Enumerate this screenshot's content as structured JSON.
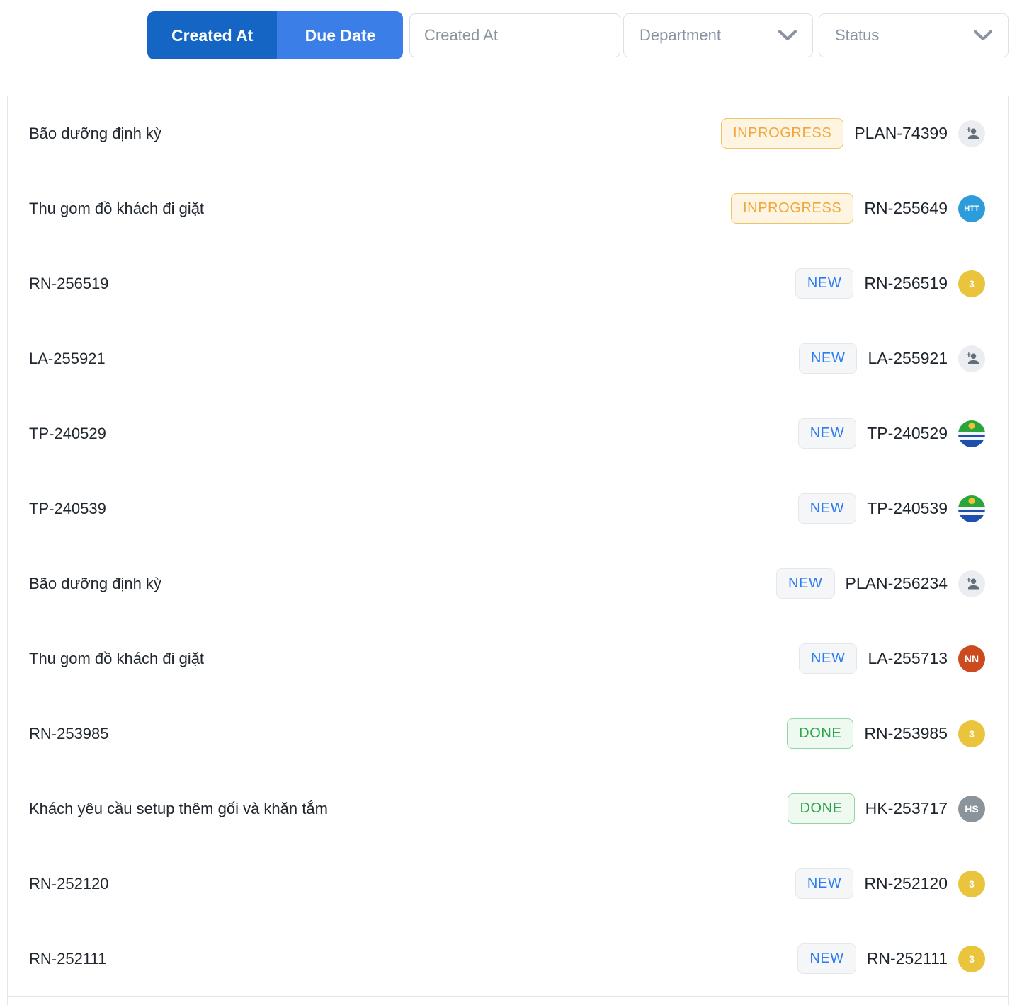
{
  "toolbar": {
    "toggle_created_at": "Created At",
    "toggle_due_date": "Due Date",
    "date_input_placeholder": "Created At",
    "department_label": "Department",
    "status_label": "Status"
  },
  "icons": {
    "department_dropdown": "chevron-down",
    "status_dropdown": "chevron-down",
    "unassigned_avatar": "person-add"
  },
  "colors": {
    "toggle_active_bg": "#1565c4",
    "toggle_inactive_bg": "#3b7ee8",
    "badge_inprogress_text": "#f0a63c",
    "badge_inprogress_bg": "#fdf5e1",
    "badge_inprogress_border": "#f3c36a",
    "badge_new_text": "#2b7bf3",
    "badge_new_bg": "#f5f6f8",
    "badge_new_border": "#e4e7ec",
    "badge_done_text": "#2aa34a",
    "badge_done_bg": "#eef9f0",
    "badge_done_border": "#8fd6a0",
    "row_border": "#e4e7ea",
    "title_text": "#21272e",
    "muted_text": "#8a93a3",
    "avatar_assign_bg": "#ebedf0",
    "avatar_assign_glyph": "#646d78",
    "logo_green": "#2aa53c",
    "logo_blue": "#1e4fae",
    "logo_yellow": "#f2c230"
  },
  "rows": [
    {
      "title": "Bão dưỡng định kỳ",
      "status": "INPROGRESS",
      "status_type": "inprogress",
      "id": "PLAN-74399",
      "avatar": {
        "type": "assign"
      }
    },
    {
      "title": "Thu gom đồ khách đi giặt",
      "status": "INPROGRESS",
      "status_type": "inprogress",
      "id": "RN-255649",
      "avatar": {
        "type": "initials",
        "text": "HTT",
        "color": "#2d9cdb"
      }
    },
    {
      "title": "RN-256519",
      "status": "NEW",
      "status_type": "new",
      "id": "RN-256519",
      "avatar": {
        "type": "initials",
        "text": "3",
        "color": "#e9c43c"
      }
    },
    {
      "title": "LA-255921",
      "status": "NEW",
      "status_type": "new",
      "id": "LA-255921",
      "avatar": {
        "type": "assign"
      }
    },
    {
      "title": "TP-240529",
      "status": "NEW",
      "status_type": "new",
      "id": "TP-240529",
      "avatar": {
        "type": "logo"
      }
    },
    {
      "title": "TP-240539",
      "status": "NEW",
      "status_type": "new",
      "id": "TP-240539",
      "avatar": {
        "type": "logo"
      }
    },
    {
      "title": "Bão dưỡng định kỳ",
      "status": "NEW",
      "status_type": "new",
      "id": "PLAN-256234",
      "avatar": {
        "type": "assign"
      }
    },
    {
      "title": "Thu gom đồ khách đi giặt",
      "status": "NEW",
      "status_type": "new",
      "id": "LA-255713",
      "avatar": {
        "type": "initials",
        "text": "NN",
        "color": "#cc4b1e"
      }
    },
    {
      "title": "RN-253985",
      "status": "DONE",
      "status_type": "done",
      "id": "RN-253985",
      "avatar": {
        "type": "initials",
        "text": "3",
        "color": "#e9c43c"
      }
    },
    {
      "title": "Khách yêu cầu setup thêm gối và khăn tắm",
      "status": "DONE",
      "status_type": "done",
      "id": "HK-253717",
      "avatar": {
        "type": "initials",
        "text": "HS",
        "color": "#8b939b"
      }
    },
    {
      "title": "RN-252120",
      "status": "NEW",
      "status_type": "new",
      "id": "RN-252120",
      "avatar": {
        "type": "initials",
        "text": "3",
        "color": "#e9c43c"
      }
    },
    {
      "title": "RN-252111",
      "status": "NEW",
      "status_type": "new",
      "id": "RN-252111",
      "avatar": {
        "type": "initials",
        "text": "3",
        "color": "#e9c43c"
      }
    }
  ]
}
